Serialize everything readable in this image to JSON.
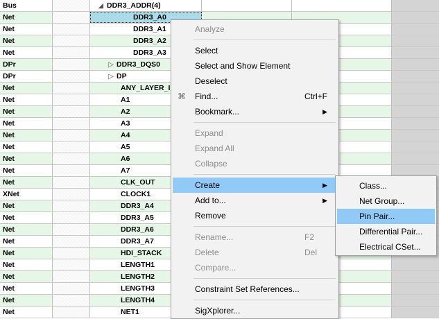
{
  "rows": [
    {
      "type": "Bus",
      "name": "DDR3_ADDR(4)",
      "indent": 12,
      "toggle": "expanded",
      "bg": "white"
    },
    {
      "type": "Net",
      "name": "DDR3_A0",
      "indent": 62,
      "toggle": "",
      "bg": "green",
      "selected": true
    },
    {
      "type": "Net",
      "name": "DDR3_A1",
      "indent": 62,
      "toggle": "",
      "bg": "white"
    },
    {
      "type": "Net",
      "name": "DDR3_A2",
      "indent": 62,
      "toggle": "",
      "bg": "green"
    },
    {
      "type": "Net",
      "name": "DDR3_A3",
      "indent": 62,
      "toggle": "",
      "bg": "white"
    },
    {
      "type": "DPr",
      "name": "DDR3_DQS0",
      "indent": 26,
      "toggle": "collapsed",
      "bg": "green"
    },
    {
      "type": "DPr",
      "name": "DP",
      "indent": 26,
      "toggle": "collapsed",
      "bg": "white"
    },
    {
      "type": "Net",
      "name": "ANY_LAYER_I",
      "indent": 44,
      "toggle": "",
      "bg": "green"
    },
    {
      "type": "Net",
      "name": "A1",
      "indent": 44,
      "toggle": "",
      "bg": "white"
    },
    {
      "type": "Net",
      "name": "A2",
      "indent": 44,
      "toggle": "",
      "bg": "green"
    },
    {
      "type": "Net",
      "name": "A3",
      "indent": 44,
      "toggle": "",
      "bg": "white"
    },
    {
      "type": "Net",
      "name": "A4",
      "indent": 44,
      "toggle": "",
      "bg": "green"
    },
    {
      "type": "Net",
      "name": "A5",
      "indent": 44,
      "toggle": "",
      "bg": "white"
    },
    {
      "type": "Net",
      "name": "A6",
      "indent": 44,
      "toggle": "",
      "bg": "green"
    },
    {
      "type": "Net",
      "name": "A7",
      "indent": 44,
      "toggle": "",
      "bg": "white"
    },
    {
      "type": "Net",
      "name": "CLK_OUT",
      "indent": 44,
      "toggle": "",
      "bg": "green"
    },
    {
      "type": "XNet",
      "name": "CLOCK1",
      "indent": 44,
      "toggle": "",
      "bg": "white"
    },
    {
      "type": "Net",
      "name": "DDR3_A4",
      "indent": 44,
      "toggle": "",
      "bg": "green"
    },
    {
      "type": "Net",
      "name": "DDR3_A5",
      "indent": 44,
      "toggle": "",
      "bg": "white"
    },
    {
      "type": "Net",
      "name": "DDR3_A6",
      "indent": 44,
      "toggle": "",
      "bg": "green"
    },
    {
      "type": "Net",
      "name": "DDR3_A7",
      "indent": 44,
      "toggle": "",
      "bg": "white"
    },
    {
      "type": "Net",
      "name": "HDI_STACK",
      "indent": 44,
      "toggle": "",
      "bg": "green"
    },
    {
      "type": "Net",
      "name": "LENGTH1",
      "indent": 44,
      "toggle": "",
      "bg": "white"
    },
    {
      "type": "Net",
      "name": "LENGTH2",
      "indent": 44,
      "toggle": "",
      "bg": "green"
    },
    {
      "type": "Net",
      "name": "LENGTH3",
      "indent": 44,
      "toggle": "",
      "bg": "white"
    },
    {
      "type": "Net",
      "name": "LENGTH4",
      "indent": 44,
      "toggle": "",
      "bg": "green"
    },
    {
      "type": "Net",
      "name": "NET1",
      "indent": 44,
      "toggle": "",
      "bg": "white"
    }
  ],
  "context_menu": {
    "items": [
      {
        "label": "Analyze",
        "disabled": true
      },
      {
        "separator": true
      },
      {
        "label": "Select"
      },
      {
        "label": "Select and Show Element"
      },
      {
        "label": "Deselect"
      },
      {
        "label": "Find...",
        "shortcut": "Ctrl+F",
        "icon": "find-icon"
      },
      {
        "label": "Bookmark...",
        "submenu": true
      },
      {
        "separator": true
      },
      {
        "label": "Expand",
        "disabled": true
      },
      {
        "label": "Expand All",
        "disabled": true
      },
      {
        "label": "Collapse",
        "disabled": true
      },
      {
        "separator": true
      },
      {
        "label": "Create",
        "submenu": true,
        "highlighted": true
      },
      {
        "label": "Add to...",
        "submenu": true
      },
      {
        "label": "Remove"
      },
      {
        "separator": true
      },
      {
        "label": "Rename...",
        "shortcut": "F2",
        "disabled": true
      },
      {
        "label": "Delete",
        "shortcut": "Del",
        "disabled": true
      },
      {
        "label": "Compare...",
        "disabled": true
      },
      {
        "separator": true
      },
      {
        "label": "Constraint Set References..."
      },
      {
        "separator": true
      },
      {
        "label": "SigXplorer..."
      }
    ]
  },
  "create_submenu": {
    "items": [
      {
        "label": "Class..."
      },
      {
        "label": "Net Group..."
      },
      {
        "label": "Pin Pair...",
        "highlighted": true
      },
      {
        "label": "Differential Pair..."
      },
      {
        "label": "Electrical CSet..."
      }
    ]
  },
  "colors": {
    "row_green": "#e7f7e7",
    "selected_cell": "#a9dbe9",
    "menu_highlight": "#91c9f7",
    "menu_bg": "#f2f2f2"
  }
}
